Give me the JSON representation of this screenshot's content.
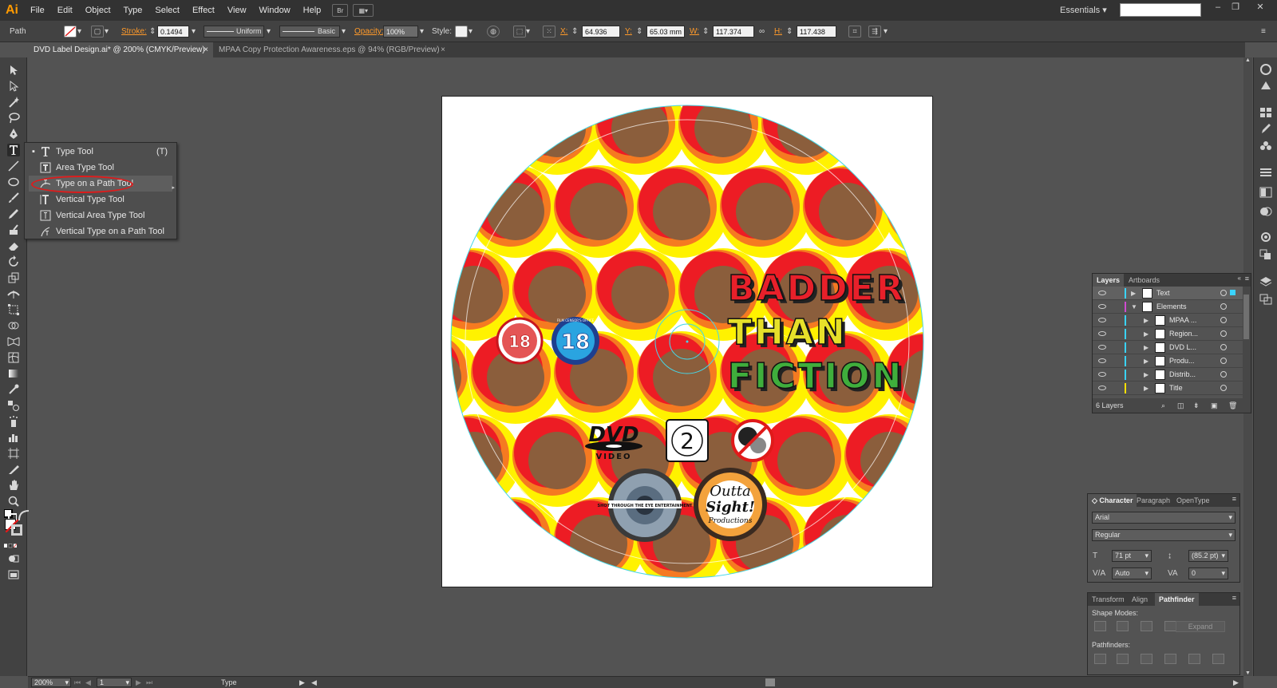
{
  "app": {
    "logo": "Ai"
  },
  "menu": [
    "File",
    "Edit",
    "Object",
    "Type",
    "Select",
    "Effect",
    "View",
    "Window",
    "Help"
  ],
  "menubar_icons": {
    "bridge": "Br"
  },
  "workspace": "Essentials",
  "control_bar": {
    "selection_type": "Path",
    "stroke_label": "Stroke:",
    "stroke_weight": "0.1494 p",
    "profile": "Uniform",
    "brush": "Basic",
    "opacity_label": "Opacity:",
    "opacity": "100%",
    "style_label": "Style:",
    "x_label": "X:",
    "x": "64.936 mm",
    "y_label": "Y:",
    "y": "65.03 mm",
    "w_label": "W:",
    "w": "117.374 mm",
    "h_label": "H:",
    "h": "117.438 mm"
  },
  "tabs": [
    {
      "label": "DVD Label Design.ai* @ 200% (CMYK/Preview)",
      "close": "×"
    },
    {
      "label": "MPAA Copy Protection Awareness.eps @ 94% (RGB/Preview)",
      "close": "×"
    }
  ],
  "flyout": {
    "bullet": "▪",
    "items": [
      {
        "label": "Type Tool",
        "shortcut": "(T)"
      },
      {
        "label": "Area Type Tool"
      },
      {
        "label": "Type on a Path Tool"
      },
      {
        "label": "Vertical Type Tool"
      },
      {
        "label": "Vertical Area Type Tool"
      },
      {
        "label": "Vertical Type on a Path Tool"
      }
    ]
  },
  "artwork": {
    "headline": [
      "BADDER",
      "THAN",
      "FICTION"
    ],
    "headline_colors": [
      "#e8202a",
      "#e6e02a",
      "#3fae3c"
    ],
    "rating_badge_1": "18",
    "rating_badge_2": "18",
    "badge_2_ring": "FILM CENSOR'S OFFICE",
    "dvd_logo": "DVD",
    "dvd_sub": "VIDEO",
    "region": "2",
    "distributor_text": "SHOT THROUGH THE EYE ENTERTAINMENT",
    "producer_line1": "Outta",
    "producer_line2": "Sight!",
    "producer_line3": "Productions",
    "pattern_colors": {
      "yellow": "#fff200",
      "orange": "#f57a21",
      "red": "#ed1c24",
      "brown": "#8b5e3c"
    }
  },
  "layers_panel": {
    "tabs": [
      "Layers",
      "Artboards"
    ],
    "rows": [
      {
        "name": "Text",
        "color": "#3ad3ff",
        "expanded": false,
        "indent": 0
      },
      {
        "name": "Elements",
        "color": "#d04bd0",
        "expanded": true,
        "indent": 0
      },
      {
        "name": "MPAA ...",
        "color": "#3ad3ff",
        "expanded": false,
        "indent": 1
      },
      {
        "name": "Region...",
        "color": "#3ad3ff",
        "expanded": false,
        "indent": 1
      },
      {
        "name": "DVD L...",
        "color": "#3ad3ff",
        "expanded": false,
        "indent": 1
      },
      {
        "name": "Produ...",
        "color": "#3ad3ff",
        "expanded": false,
        "indent": 1
      },
      {
        "name": "Distrib...",
        "color": "#3ad3ff",
        "expanded": false,
        "indent": 1
      },
      {
        "name": "Title",
        "color": "#ffe000",
        "expanded": false,
        "indent": 1
      }
    ],
    "count": "6 Layers"
  },
  "character_panel": {
    "tabs": [
      "Character",
      "Paragraph",
      "OpenType"
    ],
    "font": "Arial",
    "style": "Regular",
    "size": "71 pt",
    "leading": "(85.2 pt)",
    "kerning": "Auto",
    "tracking": "0"
  },
  "pathfinder_panel": {
    "tabs": [
      "Transform",
      "Align",
      "Pathfinder"
    ],
    "shape_modes": "Shape Modes:",
    "pathfinders": "Pathfinders:",
    "expand": "Expand"
  },
  "status_bar": {
    "zoom": "200%",
    "artboard": "1",
    "tool": "Type"
  }
}
